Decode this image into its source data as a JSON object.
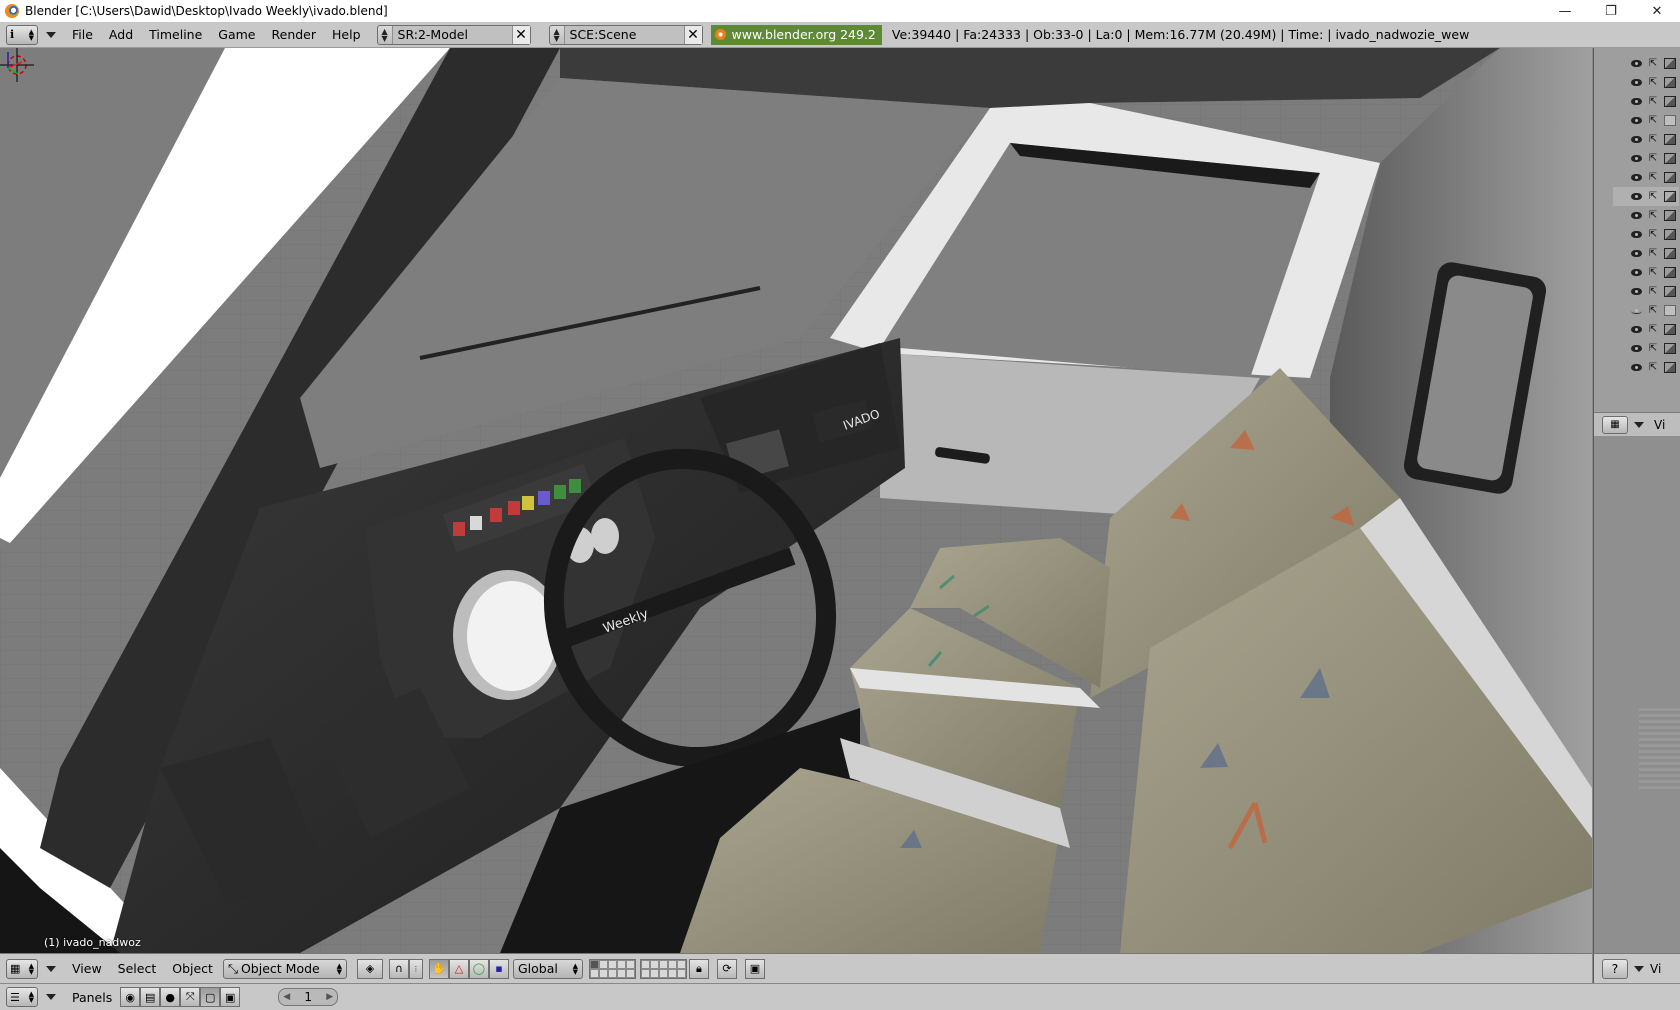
{
  "window": {
    "title": "Blender [C:\\Users\\Dawid\\Desktop\\Ivado Weekly\\ivado.blend]",
    "minimize": "—",
    "maximize": "❐",
    "close": "✕"
  },
  "info_header": {
    "menus": [
      "File",
      "Add",
      "Timeline",
      "Game",
      "Render",
      "Help"
    ],
    "screen": "SR:2-Model",
    "scene": "SCE:Scene",
    "website": "www.blender.org 249.2",
    "stats": "Ve:39440 | Fa:24333 | Ob:33-0 | La:0  | Mem:16.77M (20.49M)  | Time: | ivado_nadwozie_wew"
  },
  "viewport": {
    "object_label": "(1) ivado_nadwoz",
    "dash_brand": "IVADO",
    "wheel_text": "Weekly"
  },
  "outliner": {
    "header_label": "Vi",
    "rows": [
      {
        "visible": true,
        "render": true
      },
      {
        "visible": true,
        "render": true
      },
      {
        "visible": true,
        "render": true
      },
      {
        "visible": true,
        "render": false
      },
      {
        "visible": true,
        "render": true
      },
      {
        "visible": true,
        "render": true
      },
      {
        "visible": true,
        "render": true
      },
      {
        "visible": true,
        "render": true
      },
      {
        "visible": true,
        "render": true
      },
      {
        "visible": true,
        "render": true
      },
      {
        "visible": true,
        "render": true
      },
      {
        "visible": true,
        "render": true
      },
      {
        "visible": true,
        "render": true
      },
      {
        "visible": false,
        "render": false
      },
      {
        "visible": true,
        "render": true
      },
      {
        "visible": true,
        "render": true
      },
      {
        "visible": true,
        "render": true
      }
    ]
  },
  "view_header": {
    "menus": [
      "View",
      "Select",
      "Object"
    ],
    "mode": "Object Mode",
    "orientation": "Global",
    "right_label": "Vi"
  },
  "buttons_header": {
    "label": "Panels",
    "frame": "1"
  }
}
